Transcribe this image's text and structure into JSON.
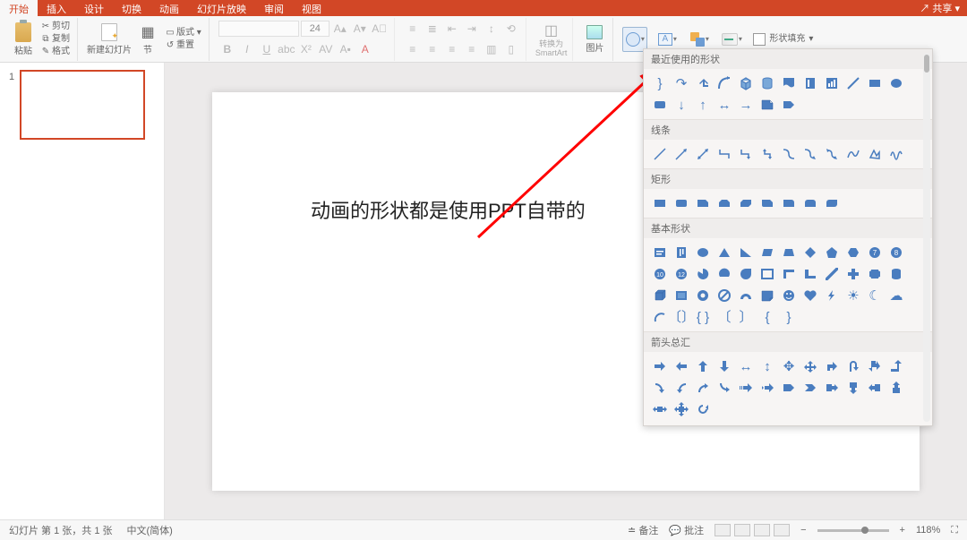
{
  "titlebar": {
    "tabs": [
      "开始",
      "插入",
      "设计",
      "切换",
      "动画",
      "幻灯片放映",
      "审阅",
      "视图"
    ],
    "active_tab": 0,
    "share_label": "共享"
  },
  "ribbon": {
    "paste": "粘贴",
    "cut": "剪切",
    "copy": "复制",
    "format_painter": "格式",
    "new_slide": "新建幻灯片",
    "section": "节",
    "layout": "版式",
    "reset": "重置",
    "font_size": "24",
    "smartart_line1": "转换为",
    "smartart_line2": "SmartArt",
    "picture": "图片",
    "shape_fill": "形状填充"
  },
  "slide": {
    "thumb_index": "1",
    "annotation_text": "动画的形状都是使用PPT自带的"
  },
  "shapes_panel": {
    "sections": {
      "recent": "最近使用的形状",
      "lines": "线条",
      "rects": "矩形",
      "basic": "基本形状",
      "arrows": "箭头总汇"
    }
  },
  "statusbar": {
    "slide_info": "幻灯片 第 1 张，共 1 张",
    "language": "中文(简体)",
    "notes": "备注",
    "comments": "批注",
    "zoom_pct": "118%"
  }
}
